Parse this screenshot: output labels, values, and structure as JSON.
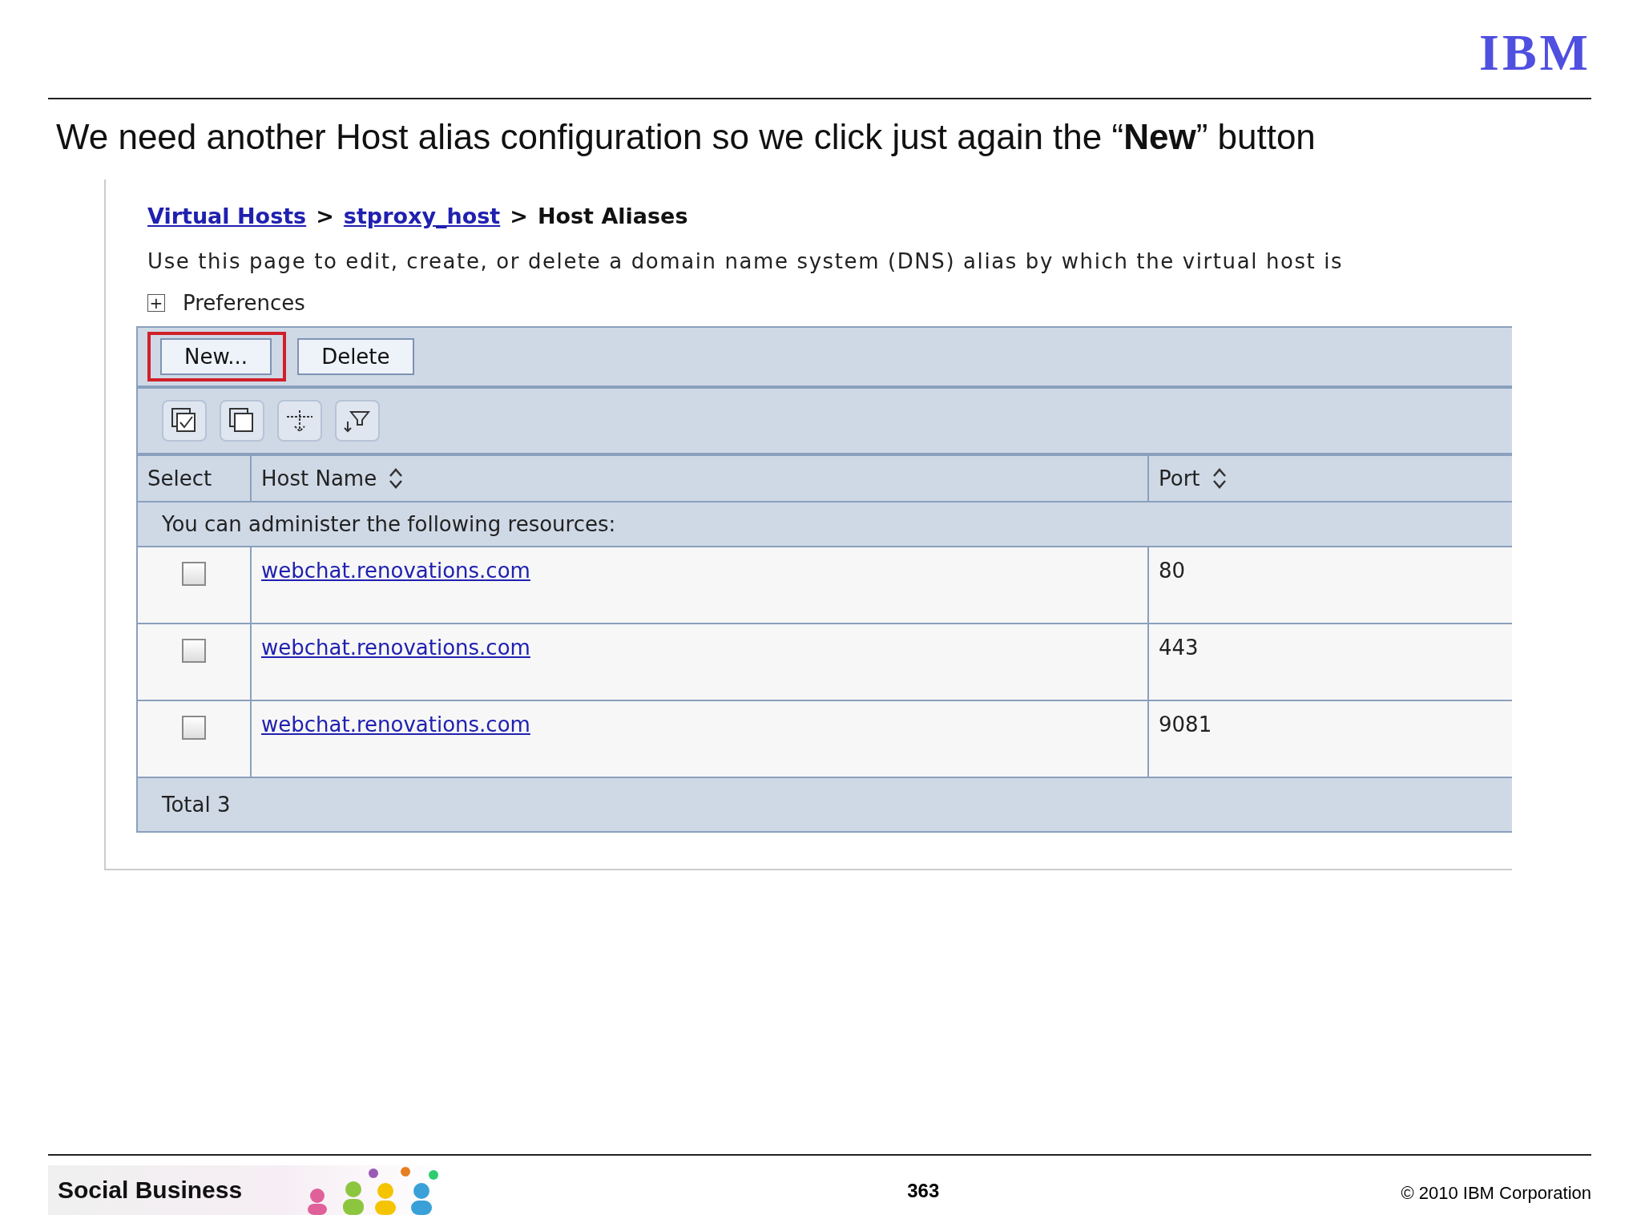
{
  "slide": {
    "logo": "IBM",
    "heading": "We need another Host alias configuration so we click just again the “**New**” button"
  },
  "console": {
    "breadcrumb": [
      {
        "label": "Virtual Hosts",
        "kind": "link"
      },
      {
        "label": ">",
        "kind": "separator"
      },
      {
        "label": "stproxy_host",
        "kind": "link"
      },
      {
        "label": ">",
        "kind": "separator"
      },
      {
        "label": "Host Aliases",
        "kind": "current"
      }
    ],
    "description": "Use this page to edit, create, or delete a domain name system (DNS) alias by which the virtual host is",
    "preferences": {
      "icon": "+",
      "label": "Preferences",
      "expanded": false
    },
    "buttons": [
      {
        "label": "New...",
        "highlighted": true
      },
      {
        "label": "Delete",
        "highlighted": false
      }
    ],
    "tools": [
      {
        "kind": "select-all"
      },
      {
        "kind": "deselect-all"
      },
      {
        "kind": "expand-filter"
      },
      {
        "kind": "filter"
      }
    ],
    "table": {
      "columns": [
        {
          "label": "Select",
          "sortable": false
        },
        {
          "label": "Host Name",
          "sortable": true
        },
        {
          "label": "Port",
          "sortable": true
        }
      ],
      "notice": "You can administer the following resources:",
      "rows": [
        {
          "checked": false,
          "host": "webchat.renovations.com",
          "port": "80"
        },
        {
          "checked": false,
          "host": "webchat.renovations.com",
          "port": "443"
        },
        {
          "checked": false,
          "host": "webchat.renovations.com",
          "port": "9081"
        }
      ],
      "total": "Total 3"
    }
  },
  "footer": {
    "brand": "Social Business",
    "page": "363",
    "copyright": "© 2010 IBM Corporation"
  }
}
